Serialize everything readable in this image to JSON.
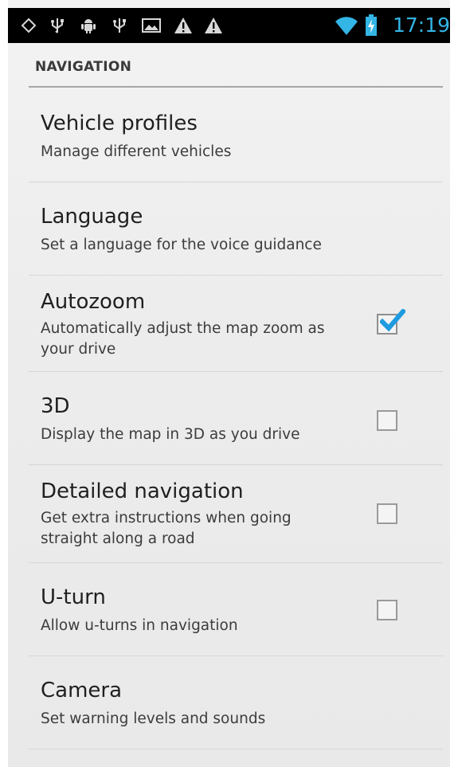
{
  "status_bar": {
    "time": "17:19",
    "time_color": "#33b5e5",
    "icons": [
      "gps-icon",
      "usb-icon",
      "android-debug-icon",
      "usb-icon",
      "image-icon",
      "warning-icon",
      "warning-icon",
      "wifi-icon",
      "battery-charging-icon"
    ]
  },
  "section": {
    "title": "NAVIGATION"
  },
  "preferences": [
    {
      "title": "Vehicle profiles",
      "summary": "Manage different vehicles"
    },
    {
      "title": "Language",
      "summary": "Set a language for the voice guidance"
    },
    {
      "title": "Autozoom",
      "summary": "Automatically adjust the map zoom as your drive",
      "checked": true
    },
    {
      "title": "3D",
      "summary": "Display the map in 3D as you drive",
      "checked": false
    },
    {
      "title": "Detailed navigation",
      "summary": "Get extra instructions when going straight along a road",
      "checked": false
    },
    {
      "title": "U-turn",
      "summary": "Allow u-turns in navigation",
      "checked": false
    },
    {
      "title": "Camera",
      "summary": "Set warning levels and sounds"
    }
  ],
  "colors": {
    "accent": "#33b5e5",
    "checkbox_tick": "#1e9be0"
  }
}
